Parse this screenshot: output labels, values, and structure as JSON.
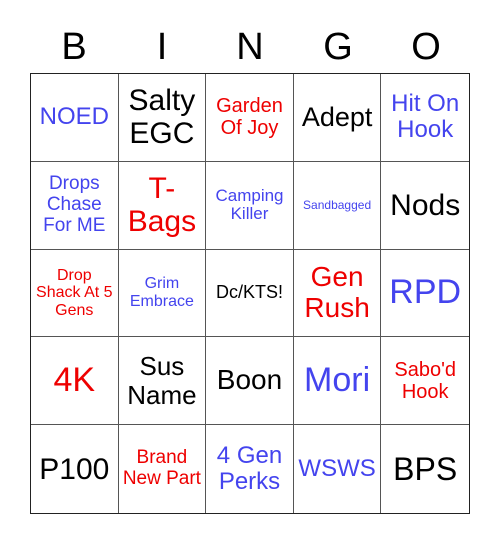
{
  "header": [
    "B",
    "I",
    "N",
    "G",
    "O"
  ],
  "colors": {
    "blue": "#4444ee",
    "red": "#ee0000",
    "black": "#000000"
  },
  "cells": [
    {
      "text": "NOED",
      "color": "blue",
      "size": 24
    },
    {
      "text": "Salty EGC",
      "color": "black",
      "size": 30
    },
    {
      "text": "Garden Of Joy",
      "color": "red",
      "size": 20
    },
    {
      "text": "Adept",
      "color": "black",
      "size": 27
    },
    {
      "text": "Hit On Hook",
      "color": "blue",
      "size": 24
    },
    {
      "text": "Drops Chase For ME",
      "color": "blue",
      "size": 19
    },
    {
      "text": "T-Bags",
      "color": "red",
      "size": 30
    },
    {
      "text": "Camping Killer",
      "color": "blue",
      "size": 17
    },
    {
      "text": "Sandbagged",
      "color": "blue",
      "size": 12
    },
    {
      "text": "Nods",
      "color": "black",
      "size": 30
    },
    {
      "text": "Drop Shack At 5 Gens",
      "color": "red",
      "size": 16
    },
    {
      "text": "Grim Embrace",
      "color": "blue",
      "size": 16
    },
    {
      "text": "Dc/KTS!",
      "color": "black",
      "size": 18
    },
    {
      "text": "Gen Rush",
      "color": "red",
      "size": 28
    },
    {
      "text": "RPD",
      "color": "blue",
      "size": 34
    },
    {
      "text": "4K",
      "color": "red",
      "size": 34
    },
    {
      "text": "Sus Name",
      "color": "black",
      "size": 26
    },
    {
      "text": "Boon",
      "color": "black",
      "size": 28
    },
    {
      "text": "Mori",
      "color": "blue",
      "size": 34
    },
    {
      "text": "Sabo'd Hook",
      "color": "red",
      "size": 20
    },
    {
      "text": "P100",
      "color": "black",
      "size": 30
    },
    {
      "text": "Brand New Part",
      "color": "red",
      "size": 19
    },
    {
      "text": "4 Gen Perks",
      "color": "blue",
      "size": 24
    },
    {
      "text": "WSWS",
      "color": "blue",
      "size": 24
    },
    {
      "text": "BPS",
      "color": "black",
      "size": 32
    }
  ]
}
